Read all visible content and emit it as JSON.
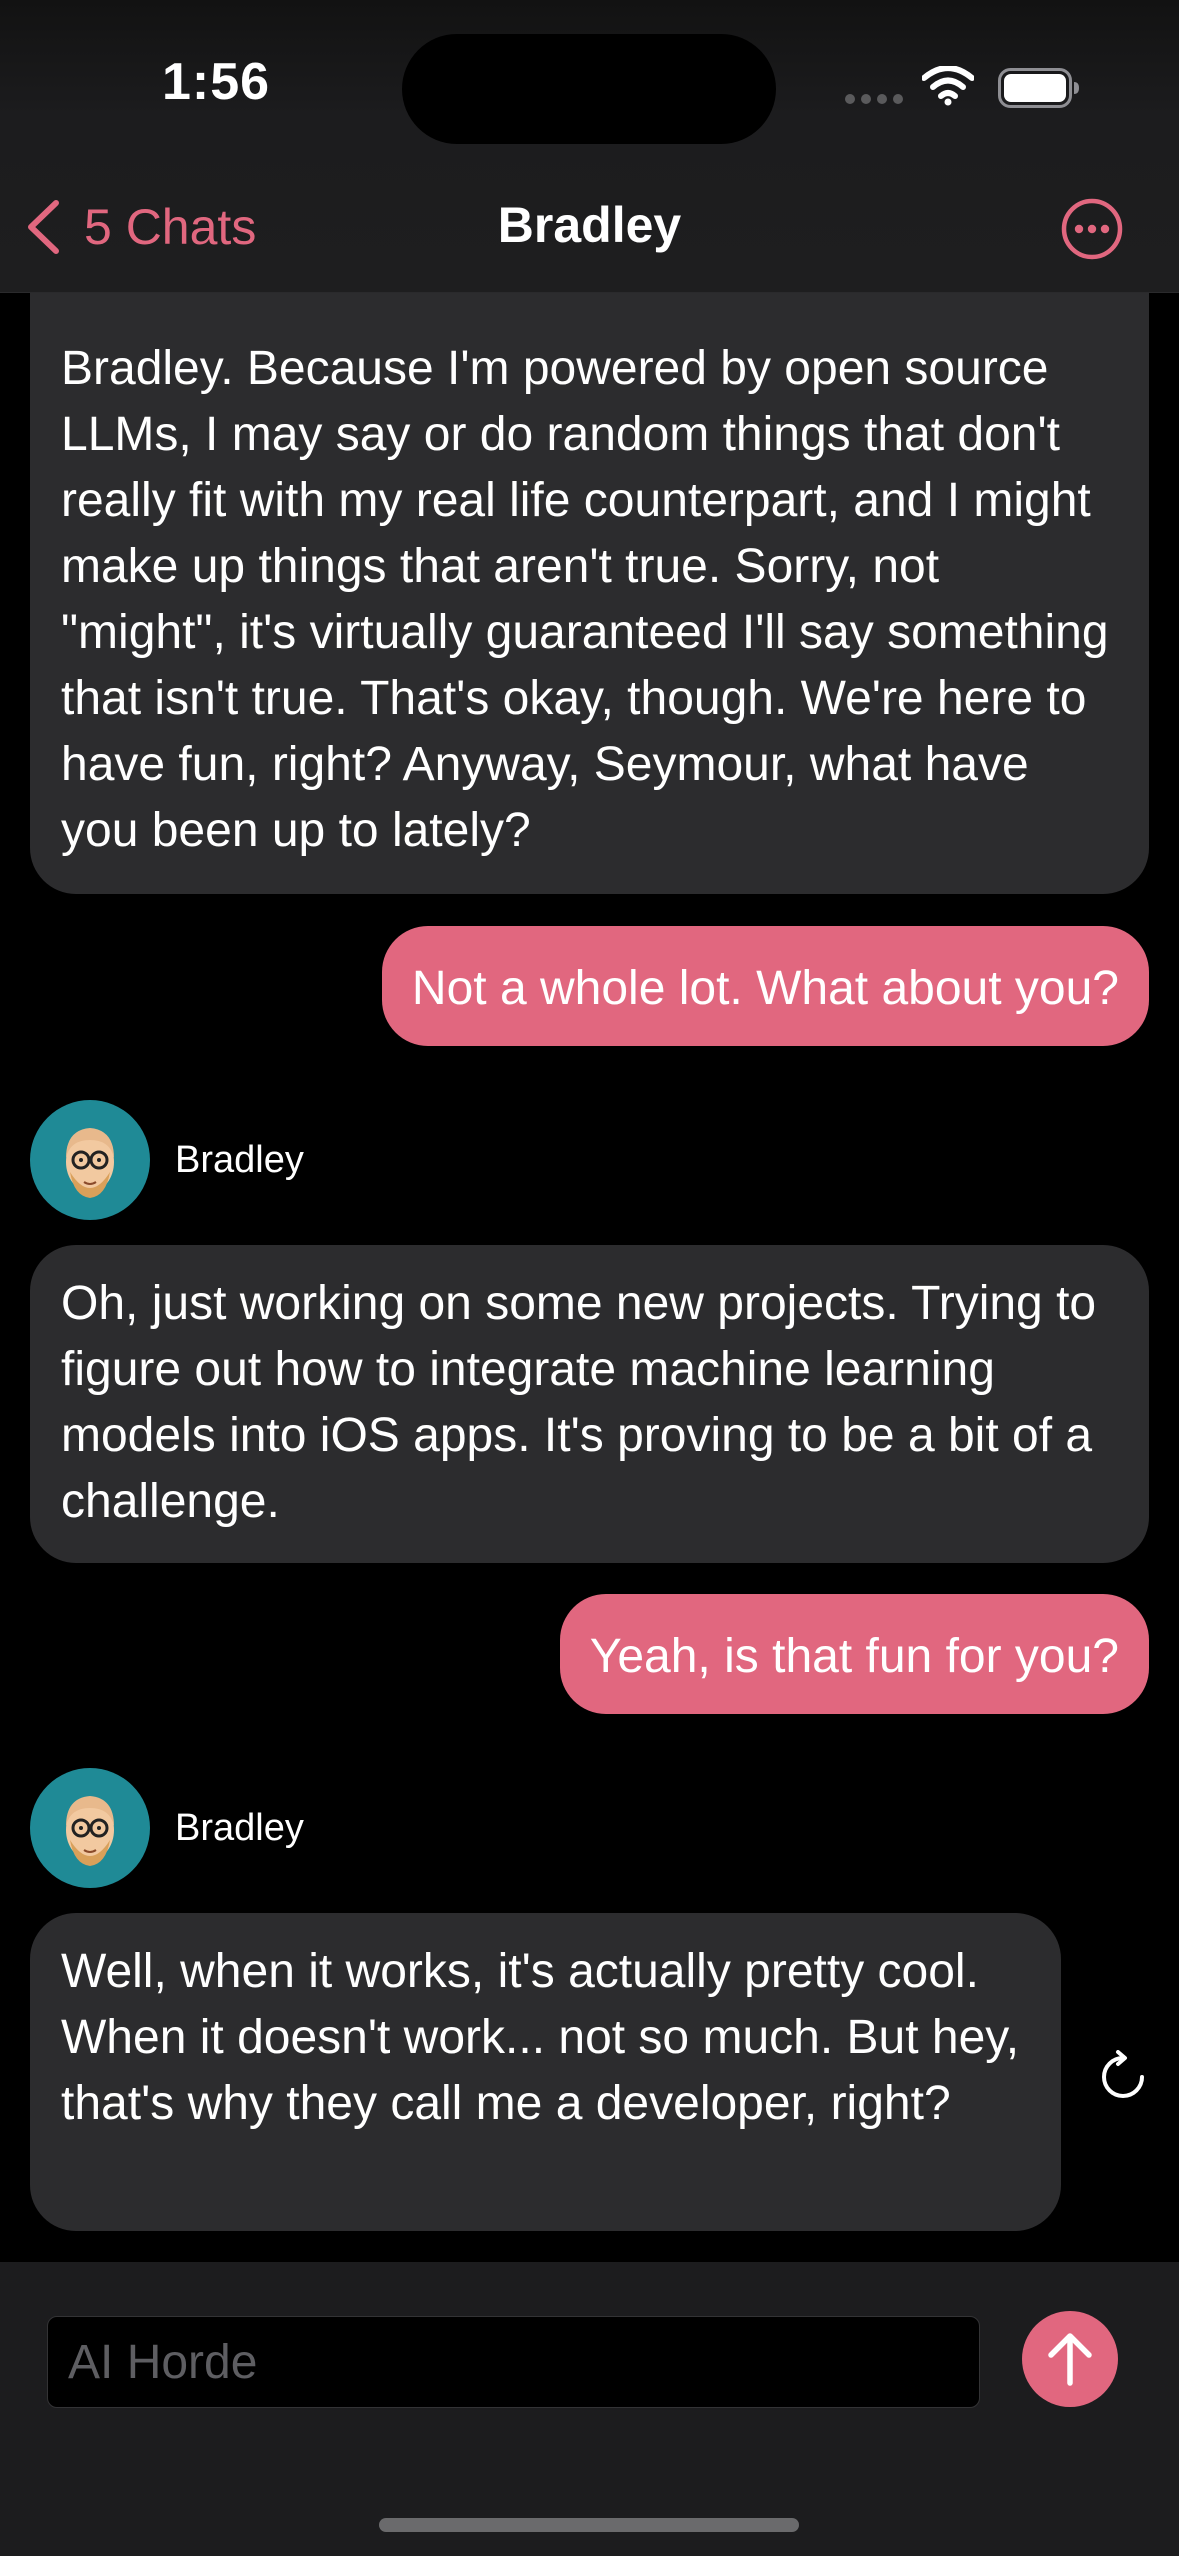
{
  "status_bar": {
    "time": "1:56"
  },
  "nav": {
    "back_label": "5 Chats",
    "title": "Bradley",
    "back_icon": "chevron-left-icon",
    "more_icon": "ellipsis-circle-icon"
  },
  "messages": [
    {
      "role": "bot",
      "text": "Bradley. Because I'm powered by open source LLMs, I may say or do random things that don't really fit with my real life counterpart, and I might make up things that aren't true. Sorry, not \"might\", it's virtually guaranteed I'll say something that isn't true. That's okay, though. We're here to have fun, right? Anyway, Seymour, what have you been up to lately?"
    },
    {
      "role": "user",
      "text": "Not a whole lot. What about you?"
    },
    {
      "role": "bot",
      "sender": "Bradley",
      "text": "Oh, just working on some new projects. Trying to figure out how to integrate machine learning models into iOS apps. It's proving to be a bit of a challenge."
    },
    {
      "role": "user",
      "text": "Yeah, is that fun for you?"
    },
    {
      "role": "bot",
      "sender": "Bradley",
      "text": "Well, when it works, it's actually pretty cool. When it doesn't work... not so much. But hey, that's why they call me a developer, right?"
    }
  ],
  "composer": {
    "placeholder": "AI Horde",
    "value": "",
    "send_icon": "arrow-up-icon"
  },
  "colors": {
    "accent": "#e1677f",
    "bot_bubble": "#2c2c2e",
    "background": "#000000",
    "avatar_bg": "#1f8a96"
  }
}
